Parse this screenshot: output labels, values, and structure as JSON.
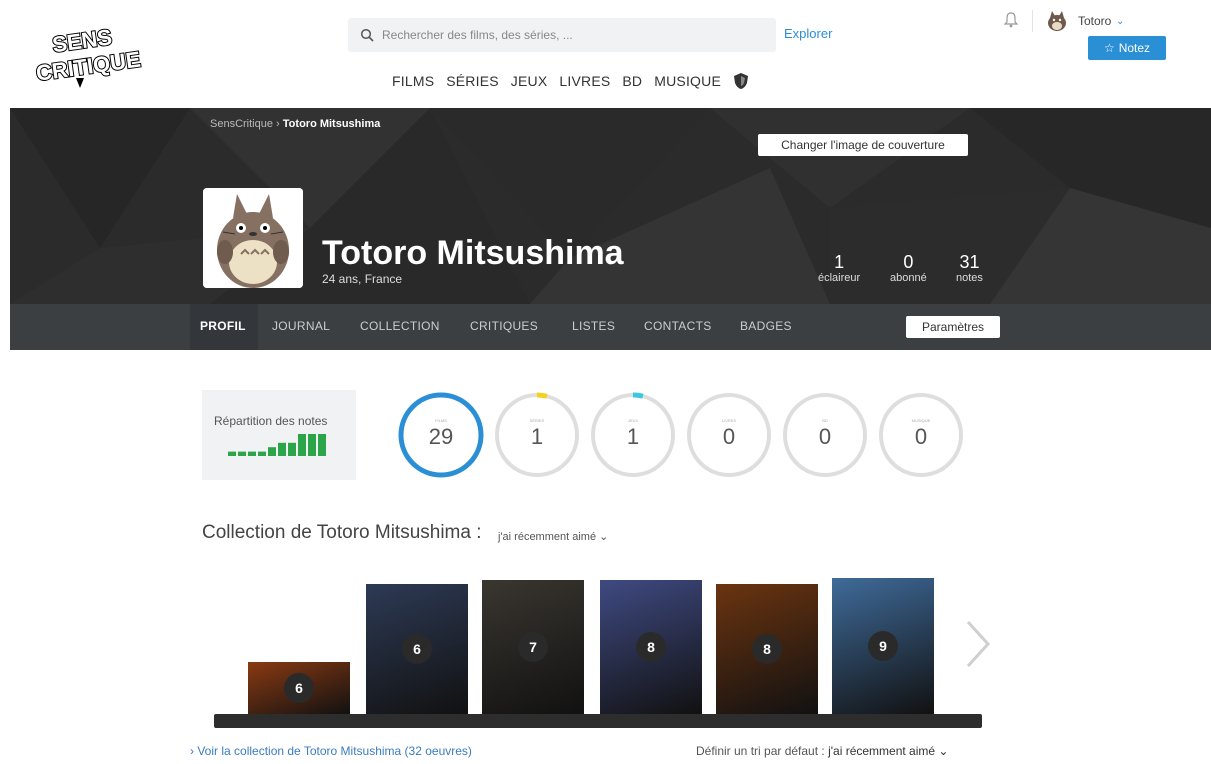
{
  "header": {
    "logo_text": "SENS CRITIQUE",
    "search_placeholder": "Rechercher des films, des séries, ...",
    "explorer_label": "Explorer",
    "nav": [
      "FILMS",
      "SÉRIES",
      "JEUX",
      "LIVRES",
      "BD",
      "MUSIQUE"
    ],
    "username": "Totoro",
    "notez_label": "Notez"
  },
  "cover": {
    "breadcrumb_root": "SensCritique",
    "breadcrumb_sep": "›",
    "breadcrumb_current": "Totoro Mitsushima",
    "change_cover_label": "Changer l'image de couverture",
    "name": "Totoro Mitsushima",
    "subtitle": "24 ans, France",
    "stats": [
      {
        "value": "1",
        "label": "éclaireur"
      },
      {
        "value": "0",
        "label": "abonné"
      },
      {
        "value": "31",
        "label": "notes"
      }
    ]
  },
  "tabs": {
    "items": [
      "PROFIL",
      "JOURNAL",
      "COLLECTION",
      "CRITIQUES",
      "LISTES",
      "CONTACTS",
      "BADGES"
    ],
    "active": "PROFIL",
    "params_label": "Paramètres"
  },
  "ratings": {
    "repartition_label": "Répartition des notes",
    "circles": [
      {
        "value": "29",
        "caption": "FILMS",
        "color": "#2b8fd6",
        "fraction": 1.0
      },
      {
        "value": "1",
        "caption": "SÉRIES",
        "color": "#f2d31b",
        "fraction": 0.04
      },
      {
        "value": "1",
        "caption": "JEUX",
        "color": "#3bc7e0",
        "fraction": 0.04
      },
      {
        "value": "0",
        "caption": "LIVRES",
        "color": "#cfcfcf",
        "fraction": 0
      },
      {
        "value": "0",
        "caption": "BD",
        "color": "#cfcfcf",
        "fraction": 0
      },
      {
        "value": "0",
        "caption": "MUSIQUE",
        "color": "#cfcfcf",
        "fraction": 0
      }
    ],
    "histogram": [
      1,
      1,
      1,
      1,
      2,
      3,
      3,
      5,
      5,
      5
    ]
  },
  "collection": {
    "title": "Collection de Totoro Mitsushima :",
    "sort_label": "j'ai récemment aimé",
    "posters": [
      {
        "rating": "6",
        "color": "#8a3a12"
      },
      {
        "rating": "6",
        "color": "#2d3a55"
      },
      {
        "rating": "7",
        "color": "#3a3630"
      },
      {
        "rating": "8",
        "color": "#3f4a82"
      },
      {
        "rating": "8",
        "color": "#6b3410"
      },
      {
        "rating": "9",
        "color": "#3f6b9a"
      }
    ],
    "see_all": "› Voir la collection de Totoro Mitsushima (32 oeuvres)",
    "default_sort_prefix": "Définir un tri par défaut :",
    "default_sort_value": "j'ai récemment aimé"
  }
}
